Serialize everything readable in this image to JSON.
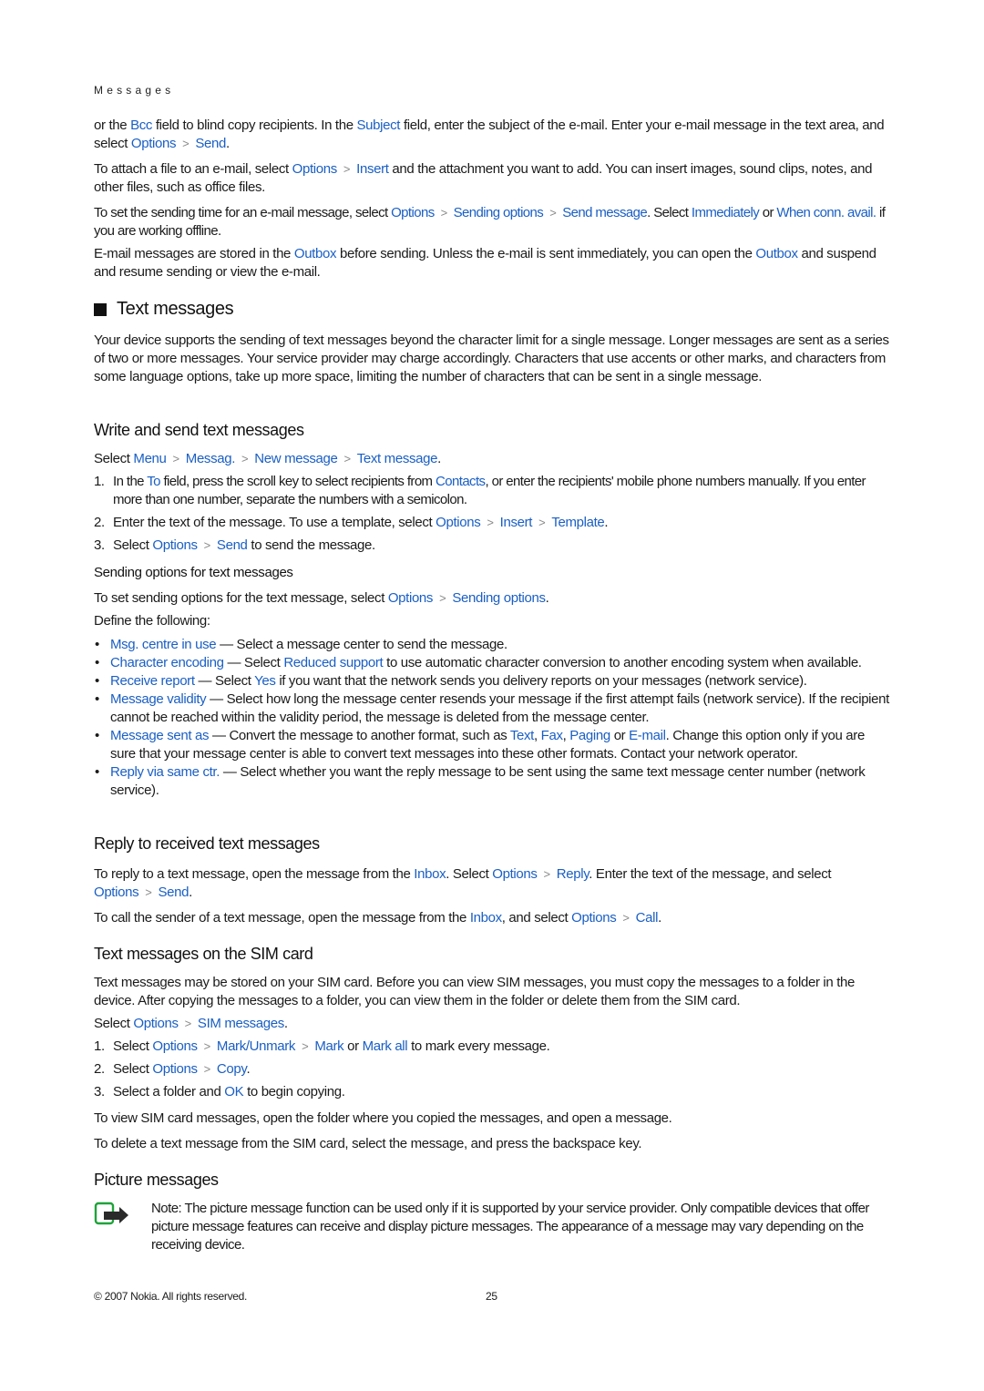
{
  "running_head": "Messages",
  "colors": {
    "link": "#1a5fc4",
    "text": "#1a1a1a",
    "note_icon_green": "#1fa33a"
  },
  "separator_glyph": ">",
  "p1": {
    "a": "or the ",
    "b": "Bcc",
    "c": " field to blind copy recipients. In the ",
    "d": "Subject",
    "e": " field, enter the subject of the e-mail. Enter your e-mail message in the text area, and select ",
    "f": "Options",
    "g": "Send",
    "h": "."
  },
  "p2": {
    "a": "To attach a file to an e-mail, select ",
    "b": "Options",
    "c": "Insert",
    "d": " and the attachment you want to add. You can insert images, sound clips, notes, and other files, such as office files."
  },
  "p3": {
    "a": "To set the sending time for an e-mail message, select ",
    "b": "Options",
    "c": "Sending options",
    "d": "Send message",
    "e": ". Select ",
    "f": "Immediately",
    "g": " or ",
    "h": "When conn. avail.",
    "i": " if you are working offline."
  },
  "p4": {
    "a": "E-mail messages are stored in the ",
    "b": "Outbox",
    "c": " before sending. Unless the e-mail is sent immediately, you can open the ",
    "d": "Outbox",
    "e": " and suspend and resume sending or view the e-mail."
  },
  "section_title": "Text messages",
  "p5": "Your device supports the sending of text messages beyond the character limit for a single message. Longer messages are sent as a series of two or more messages. Your service provider may charge accordingly. Characters that use accents or other marks, and characters from some language options, take up more space, limiting the number of characters that can be sent in a single message.",
  "write": {
    "title": "Write and send text messages",
    "path": {
      "a": "Select ",
      "b": "Menu",
      "c": "Messag.",
      "d": "New message",
      "e": "Text message",
      "f": "."
    },
    "steps": [
      {
        "n": "1.",
        "a": "In the ",
        "b": "To",
        "c": " field, press the scroll key to select recipients from ",
        "d": "Contacts",
        "e": ", or enter the recipients' mobile phone numbers manually. If you enter more than one number, separate the numbers with a semicolon."
      },
      {
        "n": "2.",
        "a": "Enter the text of the message. To use a template, select ",
        "b": "Options",
        "c": "Insert",
        "d": "Template",
        "e": "."
      },
      {
        "n": "3.",
        "a": "Select ",
        "b": "Options",
        "c": "Send",
        "d": " to send the message."
      }
    ]
  },
  "sending": {
    "title": "Sending options for text messages",
    "intro": {
      "a": "To set sending options for the text message, select ",
      "b": "Options",
      "c": "Sending options",
      "d": "."
    },
    "define": "Define the following:",
    "bullet": "•",
    "items": [
      {
        "a": "Msg. centre in use",
        "b": " — Select a message center to send the message."
      },
      {
        "a": "Character encoding",
        "b": " — Select ",
        "c": "Reduced support",
        "d": " to use automatic character conversion to another encoding system when available."
      },
      {
        "a": "Receive report",
        "b": " — Select ",
        "c": "Yes",
        "d": " if you want that the network sends you delivery reports on your messages (network service)."
      },
      {
        "a": "Message validity",
        "b": " — Select how long the message center resends your message if the first attempt fails (network service). If the recipient cannot be reached within the validity period, the message is deleted from the message center."
      },
      {
        "a": "Message sent as",
        "b": " — Convert the message to another format, such as ",
        "c": "Text",
        "d": ", ",
        "e": "Fax",
        "f": ", ",
        "g": "Paging",
        "h": " or ",
        "i": "E-mail",
        "j": ". Change this option only if you are sure that your message center is able to convert text messages into these other formats. Contact your network operator."
      },
      {
        "a": "Reply via same ctr.",
        "b": " — Select whether you want the reply message to be sent using the same text message center number (network service)."
      }
    ]
  },
  "reply": {
    "title": "Reply to received text messages",
    "p1": {
      "a": "To reply to a text message, open the message from the ",
      "b": "Inbox",
      "c": ". Select ",
      "d": "Options",
      "e": "Reply",
      "f": ". Enter the text of the message, and select ",
      "g": "Options",
      "h": "Send",
      "i": "."
    },
    "p2": {
      "a": "To call the sender of a text message, open the message from the ",
      "b": "Inbox",
      "c": ", and select ",
      "d": "Options",
      "e": "Call",
      "f": "."
    }
  },
  "sim": {
    "title": "Text messages on the SIM card",
    "p1": "Text messages may be stored on your SIM card. Before you can view SIM messages, you must copy the messages to a folder in the device. After copying the messages to a folder, you can view them in the folder or delete them from the SIM card.",
    "path": {
      "a": "Select ",
      "b": "Options",
      "c": "SIM messages",
      "d": "."
    },
    "steps": [
      {
        "n": "1.",
        "a": "Select ",
        "b": "Options",
        "c": "Mark/Unmark",
        "d": "Mark",
        "e": " or ",
        "f": "Mark all",
        "g": " to mark every message."
      },
      {
        "n": "2.",
        "a": "Select ",
        "b": "Options",
        "c": "Copy",
        "d": "."
      },
      {
        "n": "3.",
        "a": "Select a folder and ",
        "b": "OK",
        "c": " to begin copying."
      }
    ],
    "p2": "To view SIM card messages, open the folder where you copied the messages, and open a message.",
    "p3": "To delete a text message from the SIM card, select the message, and press the backspace key."
  },
  "picture": {
    "title": "Picture messages",
    "note_label": "Note:",
    "note_text": " The picture message function can be used only if it is supported by your service provider. Only compatible devices that offer picture message features can receive and display picture messages. The appearance of a message may vary depending on the receiving device."
  },
  "footer": {
    "copyright": "© 2007 Nokia. All rights reserved.",
    "page_number": "25"
  }
}
